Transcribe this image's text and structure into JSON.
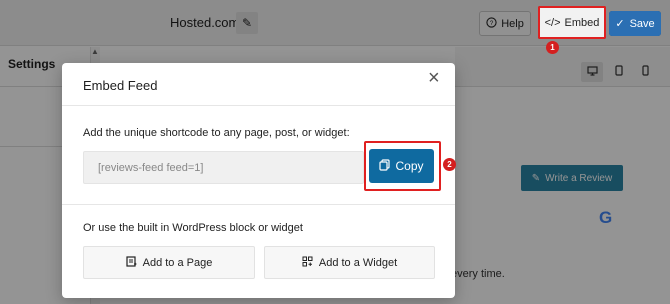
{
  "header": {
    "site_name": "Hosted.com",
    "help_label": "Help",
    "embed_label": "Embed",
    "save_label": "Save",
    "embed_step_badge": "1"
  },
  "sidebar": {
    "settings_label": "Settings"
  },
  "preview": {
    "write_review_label": "Write a Review",
    "partial_text": "every time."
  },
  "modal": {
    "title": "Embed Feed",
    "shortcode_instruction": "Add the unique shortcode to any page, post, or widget:",
    "shortcode_value": "[reviews-feed feed=1]",
    "copy_label": "Copy",
    "copy_step_badge": "2",
    "wordpress_instruction": "Or use the built in WordPress block or widget",
    "add_page_label": "Add to a Page",
    "add_widget_label": "Add to a Widget"
  },
  "colors": {
    "save_button": "#2b6fb3",
    "copy_button": "#0f6aa0",
    "highlight_outline": "#e02020",
    "write_review_button": "#2a86a6"
  }
}
